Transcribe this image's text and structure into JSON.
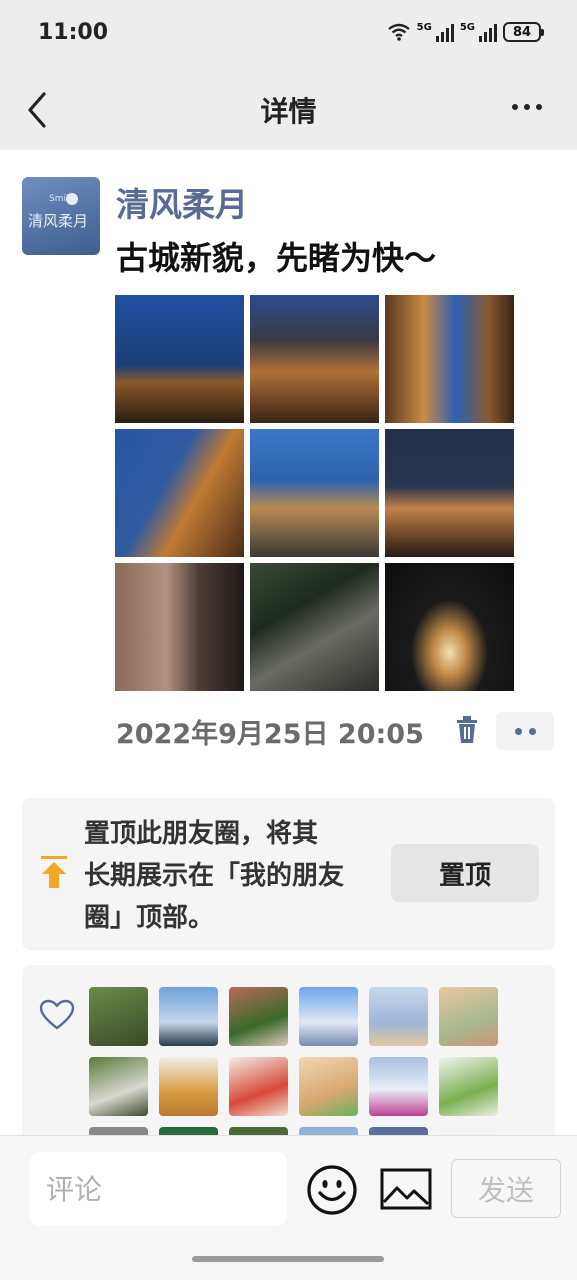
{
  "status_bar": {
    "time": "11:00",
    "signal_1_label": "5G",
    "signal_2_label": "5G",
    "battery": "84"
  },
  "nav": {
    "title": "详情",
    "back_icon": "chevron-left-icon",
    "more_icon": "more-dots-icon"
  },
  "post": {
    "author": "清风柔月",
    "avatar_text": "清风柔月",
    "avatar_small_text": "Smile",
    "text": "古城新貌，先睹为快～",
    "timestamp": "2022年9月25日 20:05 ",
    "photos": [
      {
        "name": "photo-1",
        "bg": "linear-gradient(180deg,#1f4fa0 0%,#1d3f78 55%,#8a5a2a 68%,#2a1c10 100%)"
      },
      {
        "name": "photo-2",
        "bg": "linear-gradient(180deg,#2b4d8c 0%,#3a3a44 35%,#b07038 60%,#3a2416 100%)"
      },
      {
        "name": "photo-3",
        "bg": "linear-gradient(90deg,#5a3a20 0%,#c98a45 30%,#2c5fb3 55%,#8a5a30 80%,#3a2414 100%)"
      },
      {
        "name": "photo-4",
        "bg": "linear-gradient(120deg,#2856a4 0%,#315aa0 40%,#c07a34 60%,#4a2c18 100%)"
      },
      {
        "name": "photo-5",
        "bg": "linear-gradient(180deg,#3a78c8 0%,#2d62ad 40%,#b88a50 62%,#3b3a38 100%)"
      },
      {
        "name": "photo-6",
        "bg": "linear-gradient(180deg,#23314d 0%,#2a3550 45%,#c38146 62%,#241a12 100%)"
      },
      {
        "name": "photo-7",
        "bg": "linear-gradient(90deg,#8a6a58 0%,#b39080 40%,#4d3d36 65%,#1f1a18 100%)"
      },
      {
        "name": "photo-8",
        "bg": "linear-gradient(150deg,#3a4a38 0%,#1e2a1e 35%,#6a6a64 60%,#2c2c28 100%)"
      },
      {
        "name": "photo-9",
        "bg": "radial-gradient(ellipse at 50% 70%,#f2e0b0 0%,#c08a48 18%,#1a1a1a 42%,#0d0d0d 100%)"
      }
    ]
  },
  "actions": {
    "delete_icon": "trash-icon",
    "more_icon": "two-dots-icon"
  },
  "pin_card": {
    "icon": "pin-top-arrow-icon",
    "line_1": "置顶此朋友圈，将其",
    "line_2": "长期展示在「我的朋友",
    "line_3": "圈」顶部。",
    "button": "置顶"
  },
  "likes": {
    "icon": "heart-icon",
    "avatars": [
      {
        "bg": "linear-gradient(160deg,#6c8a4a,#3a4a28)"
      },
      {
        "bg": "linear-gradient(180deg,#6fa2dc,#c4d6ea 60%,#2a3a4a)"
      },
      {
        "bg": "linear-gradient(160deg,#b86a5a,#3a6a2a 60%,#d8c8c0)"
      },
      {
        "bg": "linear-gradient(180deg,#6ea6e6,#dfe9f6 60%,#7a8ab0)"
      },
      {
        "bg": "linear-gradient(180deg,#c8d8ea,#9db6d8 60%,#e0c8a0)"
      },
      {
        "bg": "linear-gradient(160deg,#e8c8a0,#a8b890 60%,#c89878)"
      },
      {
        "bg": "linear-gradient(160deg,#5a7a3a,#d8d8d0 60%,#3a4a2a)"
      },
      {
        "bg": "linear-gradient(180deg,#f0f0ea,#d89a40 60%,#b87a30)"
      },
      {
        "bg": "linear-gradient(160deg,#f2ece6,#d84a3a 60%,#f0e0d0)"
      },
      {
        "bg": "linear-gradient(160deg,#f0d8b0,#d8a870 60%,#6ab060)"
      },
      {
        "bg": "linear-gradient(180deg,#a8c0e0,#e8eef6 55%,#c04090)"
      },
      {
        "bg": "linear-gradient(160deg,#f2f4ee,#7ab050 60%,#e8f0e0)"
      },
      {
        "bg": "linear-gradient(180deg,#8a8a8a,#6a6a6a)"
      },
      {
        "bg": "linear-gradient(180deg,#2a6a3a,#3a7a4a)"
      },
      {
        "bg": "linear-gradient(180deg,#4a6a3a,#7a5a3a)"
      },
      {
        "bg": "linear-gradient(180deg,#8ab0d8,#c8d8e8)"
      },
      {
        "bg": "linear-gradient(180deg,#5a6a9a,#8a9ac8)"
      },
      {
        "bg": "linear-gradient(180deg,#f4f4f4,#e8e8e8)"
      }
    ]
  },
  "composer": {
    "placeholder": "评论",
    "emoji_icon": "smiley-icon",
    "image_icon": "image-icon",
    "send": "发送"
  }
}
